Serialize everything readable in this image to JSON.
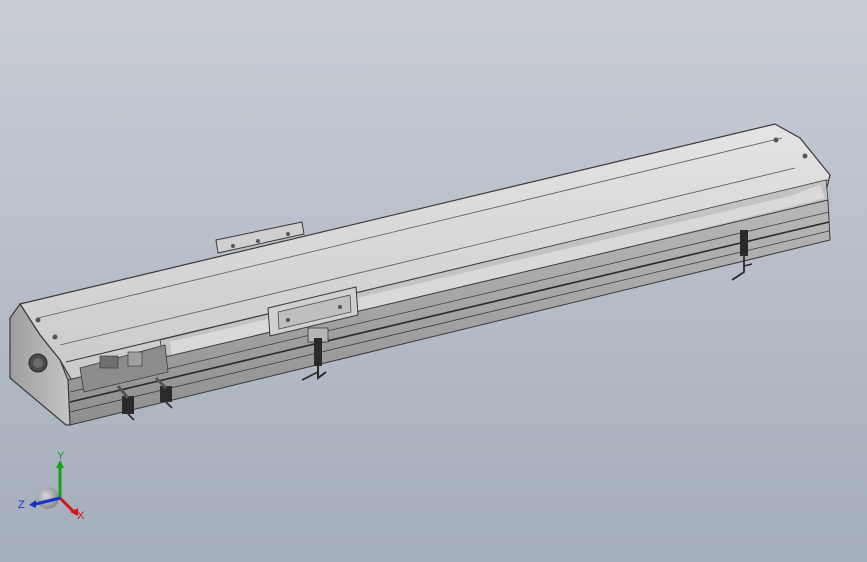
{
  "viewport": {
    "background_top": "#c9ced6",
    "background_bottom": "#a4adbb"
  },
  "model": {
    "body_color": "#d9d9d9",
    "edge_color": "#3a3a3a"
  },
  "triad": {
    "x_label": "X",
    "y_label": "Y",
    "z_label": "Z",
    "x_color": "#d01818",
    "y_color": "#18a018",
    "z_color": "#1830c8"
  }
}
